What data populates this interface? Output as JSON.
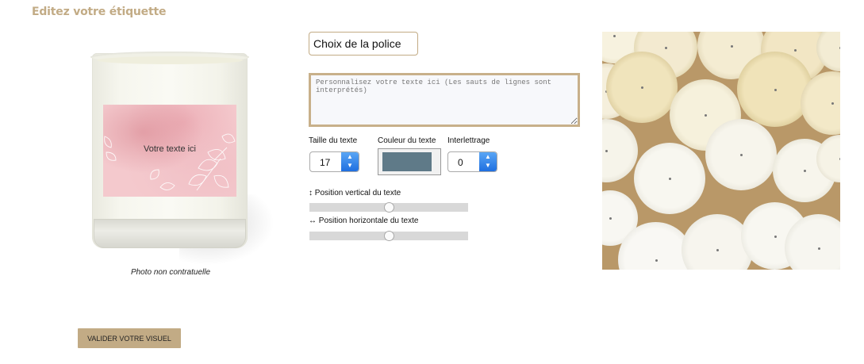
{
  "page": {
    "title": "Editez votre étiquette"
  },
  "preview": {
    "label_text": "Votre texte ici",
    "caption": "Photo non contratuelle",
    "label_color": "#f4c9cd"
  },
  "controls": {
    "font_select": {
      "label": "Choix de la police"
    },
    "text_area": {
      "value": "",
      "placeholder": "Personnalisez votre texte ici (Les sauts de lignes sont interprétés)"
    },
    "text_size": {
      "label": "Taille du texte",
      "value": "17"
    },
    "text_color": {
      "label": "Couleur du texte",
      "value": "#5f7a88"
    },
    "letter_spacing": {
      "label": "Interlettrage",
      "value": "0"
    },
    "vertical_position": {
      "label": "Position vertical du texte",
      "icon": "up-down-arrow-icon",
      "value_percent": 50
    },
    "horizontal_position": {
      "label": "Position horizontale du texte",
      "icon": "left-right-arrow-icon",
      "value_percent": 50
    }
  },
  "photo": {
    "description_icon": "tealight-candles-photo"
  },
  "actions": {
    "validate_label": "VALIDER VOTRE VISUEL"
  },
  "colors": {
    "accent": "#c2ab85",
    "text_color": "#5f7a88",
    "spinner": "#2a7de8"
  }
}
